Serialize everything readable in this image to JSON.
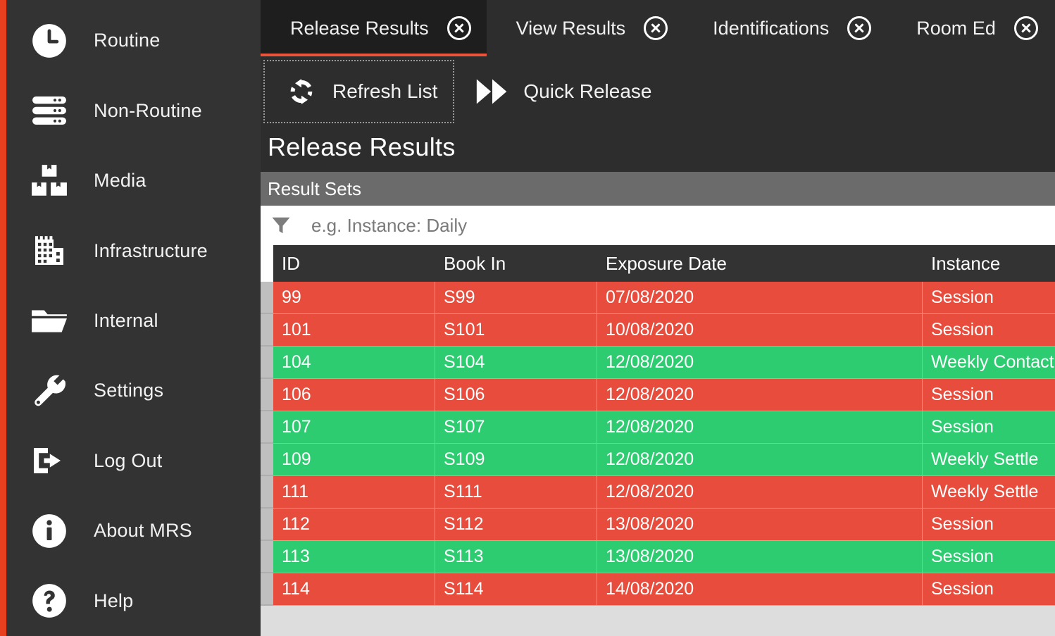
{
  "theme": {
    "accent_red": "#e8401f",
    "sidebar_bg": "#333333",
    "tab_active_bg": "#1e1e1e",
    "tab_bar_bg": "#2d2d2d",
    "panel_header_bg": "#6b6b6b",
    "status_fail": "#e74c3c",
    "status_pass": "#2ecc71",
    "grid_header_bg": "#333333",
    "grid_footer_bg": "#dddddd"
  },
  "sidebar": {
    "items": [
      {
        "label": "Routine",
        "icon": "clock-icon"
      },
      {
        "label": "Non-Routine",
        "icon": "server-icon"
      },
      {
        "label": "Media",
        "icon": "boxes-icon"
      },
      {
        "label": "Infrastructure",
        "icon": "building-icon"
      },
      {
        "label": "Internal",
        "icon": "folder-icon"
      },
      {
        "label": "Settings",
        "icon": "wrench-icon"
      },
      {
        "label": "Log Out",
        "icon": "logout-icon"
      },
      {
        "label": "About MRS",
        "icon": "info-icon"
      },
      {
        "label": "Help",
        "icon": "question-icon"
      }
    ]
  },
  "tabs": [
    {
      "label": "Release Results",
      "active": true,
      "close_icon": "close-icon"
    },
    {
      "label": "View Results",
      "active": false,
      "close_icon": "close-icon"
    },
    {
      "label": "Identifications",
      "active": false,
      "close_icon": "close-icon"
    },
    {
      "label": "Room Ed",
      "active": false,
      "close_icon": "close-icon"
    }
  ],
  "toolbar": {
    "buttons": [
      {
        "label": "Refresh List",
        "icon": "refresh-icon",
        "focused": true
      },
      {
        "label": "Quick Release",
        "icon": "fast-forward-icon",
        "focused": false
      }
    ]
  },
  "page": {
    "title": "Release Results"
  },
  "panel": {
    "header": "Result Sets"
  },
  "filter": {
    "icon": "funnel-icon",
    "value": "",
    "placeholder": "e.g. Instance: Daily"
  },
  "grid": {
    "columns": [
      {
        "key": "id",
        "label": "ID"
      },
      {
        "key": "book_in",
        "label": "Book In"
      },
      {
        "key": "exposure",
        "label": "Exposure Date"
      },
      {
        "key": "instance",
        "label": "Instance"
      }
    ],
    "rows": [
      {
        "id": "99",
        "book_in": "S99",
        "exposure": "07/08/2020",
        "instance": "Session",
        "status": "fail"
      },
      {
        "id": "101",
        "book_in": "S101",
        "exposure": "10/08/2020",
        "instance": "Session",
        "status": "fail"
      },
      {
        "id": "104",
        "book_in": "S104",
        "exposure": "12/08/2020",
        "instance": "Weekly Contact",
        "status": "pass"
      },
      {
        "id": "106",
        "book_in": "S106",
        "exposure": "12/08/2020",
        "instance": "Session",
        "status": "fail"
      },
      {
        "id": "107",
        "book_in": "S107",
        "exposure": "12/08/2020",
        "instance": "Session",
        "status": "pass"
      },
      {
        "id": "109",
        "book_in": "S109",
        "exposure": "12/08/2020",
        "instance": "Weekly Settle",
        "status": "pass"
      },
      {
        "id": "111",
        "book_in": "S111",
        "exposure": "12/08/2020",
        "instance": "Weekly Settle",
        "status": "fail"
      },
      {
        "id": "112",
        "book_in": "S112",
        "exposure": "13/08/2020",
        "instance": "Session",
        "status": "fail"
      },
      {
        "id": "113",
        "book_in": "S113",
        "exposure": "13/08/2020",
        "instance": "Session",
        "status": "pass"
      },
      {
        "id": "114",
        "book_in": "S114",
        "exposure": "14/08/2020",
        "instance": "Session",
        "status": "fail"
      }
    ]
  }
}
